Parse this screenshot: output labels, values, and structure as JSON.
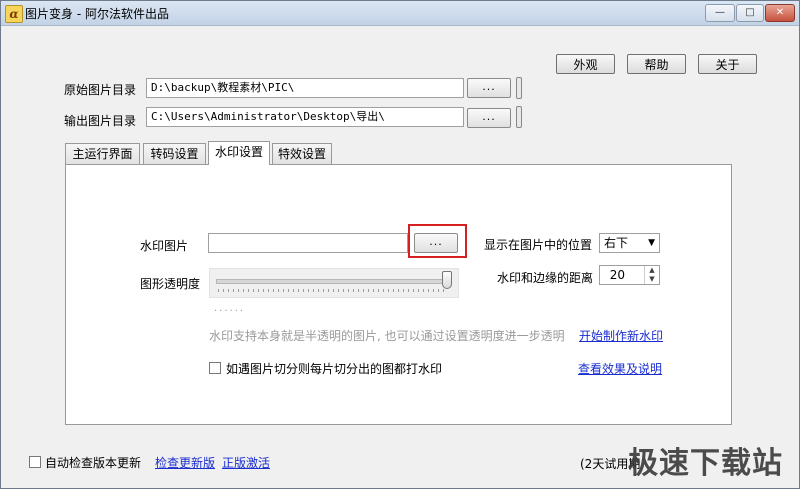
{
  "window": {
    "title": "图片变身 - 阿尔法软件出品",
    "app_icon_glyph": "α"
  },
  "window_controls": {
    "minimize": "—",
    "maximize": "□",
    "close": "✕"
  },
  "top_buttons": {
    "appearance": "外观",
    "help": "帮助",
    "about": "关于"
  },
  "source_dir": {
    "label": "原始图片目录",
    "value": "D:\\backup\\教程素材\\PIC\\",
    "browse": "..."
  },
  "output_dir": {
    "label": "输出图片目录",
    "value": "C:\\Users\\Administrator\\Desktop\\导出\\",
    "browse": "..."
  },
  "tabs": [
    {
      "label": "主运行界面",
      "active": false
    },
    {
      "label": "转码设置",
      "active": false
    },
    {
      "label": "水印设置",
      "active": true
    },
    {
      "label": "特效设置",
      "active": false
    }
  ],
  "watermark_settings": {
    "image_label": "水印图片",
    "image_value": "",
    "image_browse": "...",
    "position_label": "显示在图片中的位置",
    "position_value": "右下",
    "opacity_label": "图形透明度",
    "opacity_level": 1.0,
    "opacity_dots": "......",
    "margin_label": "水印和边缘的距离",
    "margin_value": "20",
    "hint": "水印支持本身就是半透明的图片, 也可以通过设置透明度进一步透明",
    "create_link": "开始制作新水印",
    "slice_checkbox_label": "如遇图片切分则每片切分出的图都打水印",
    "slice_checked": false,
    "help_link": "查看效果及说明"
  },
  "footer": {
    "auto_check_label": "自动检查版本更新",
    "auto_check_checked": false,
    "check_update_link": "检查更新版",
    "activate_link": "正版激活",
    "trial_text": "(2天试用期"
  },
  "site_watermark": "极速下载站",
  "colors": {
    "highlight": "#d42020",
    "link": "#1a2dd0"
  }
}
